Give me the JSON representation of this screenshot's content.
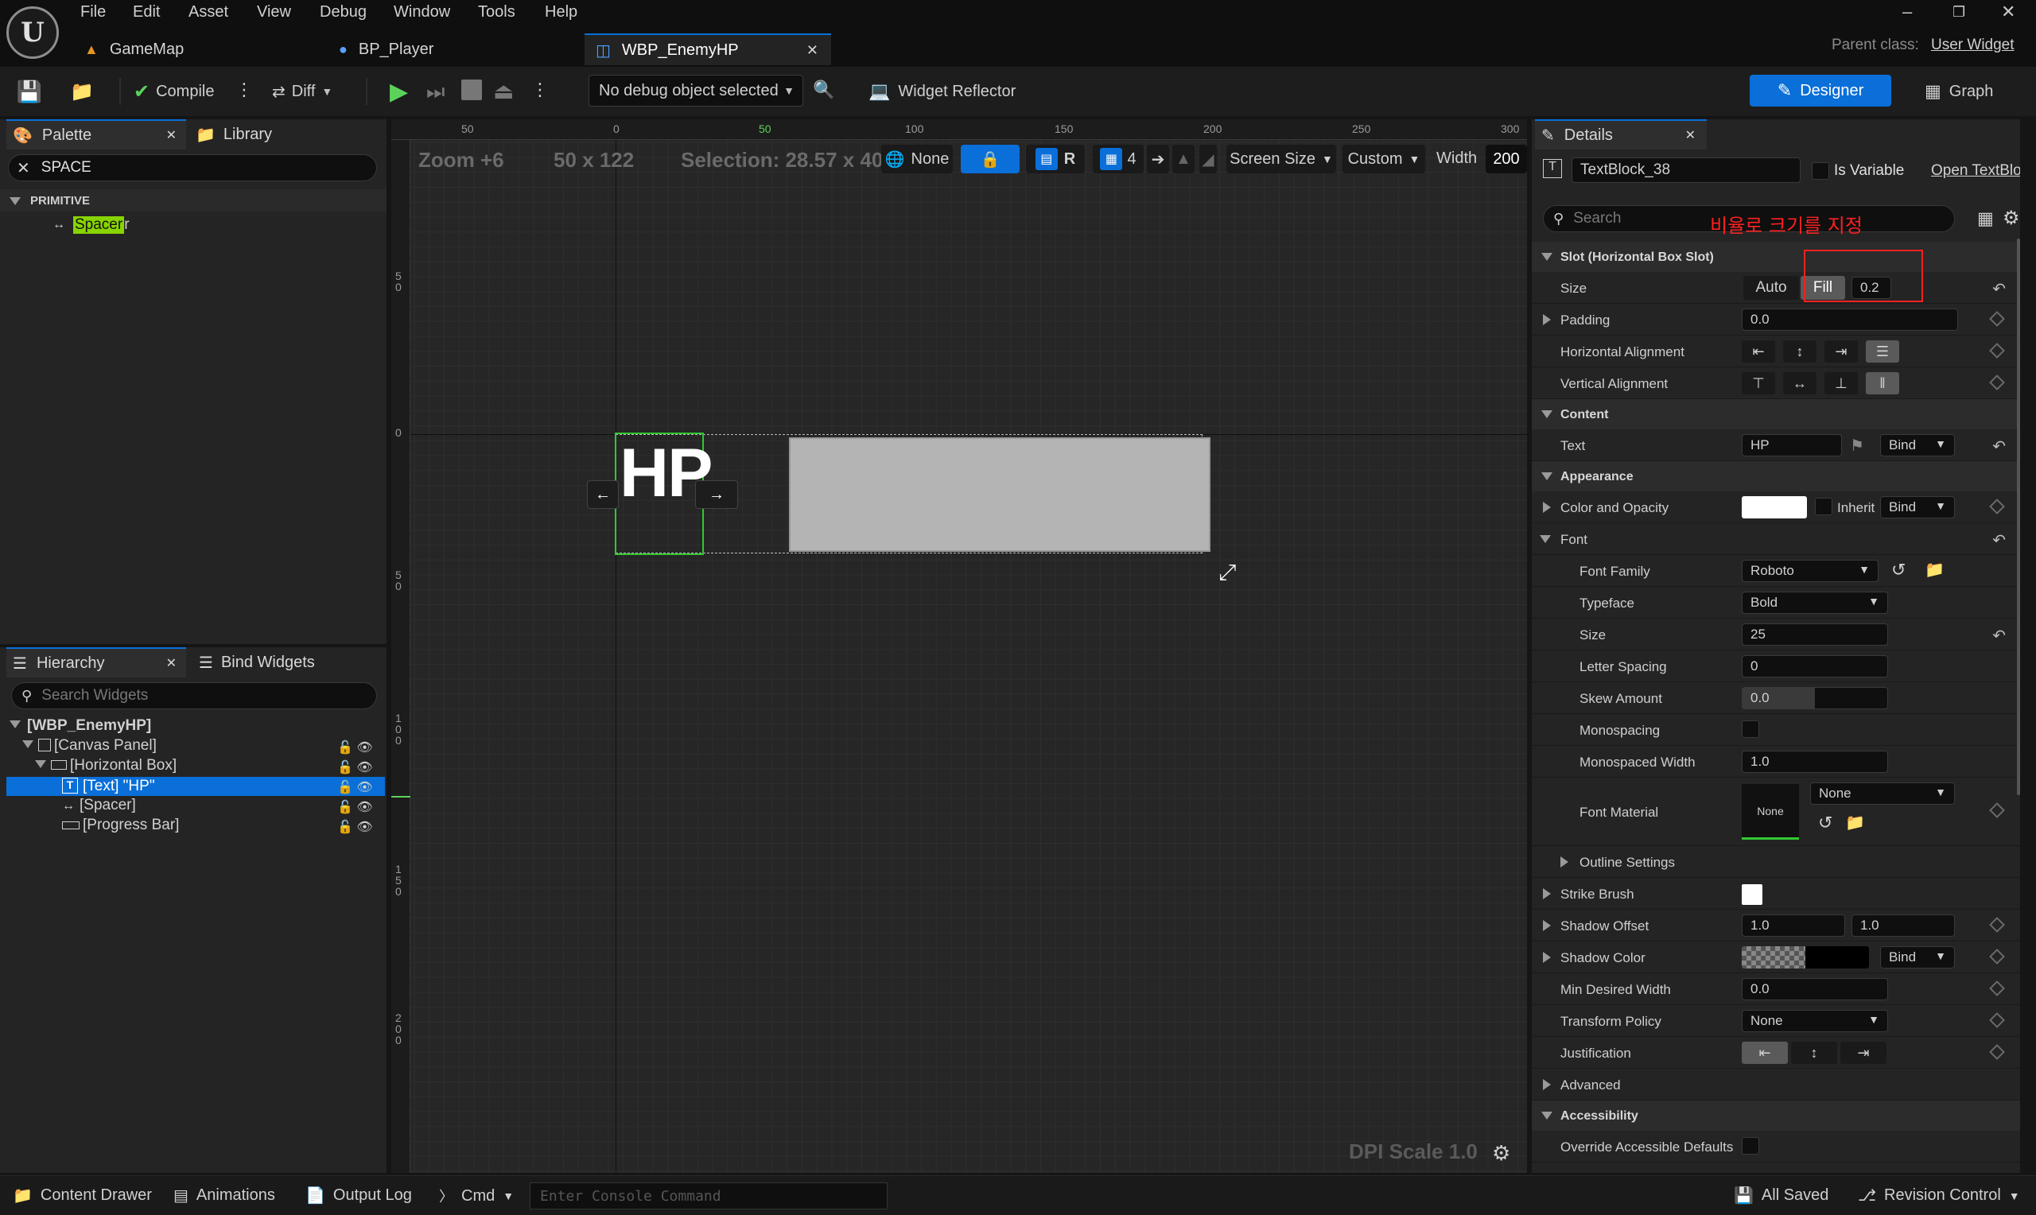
{
  "menu": {
    "items": [
      "File",
      "Edit",
      "Asset",
      "View",
      "Debug",
      "Window",
      "Tools",
      "Help"
    ]
  },
  "tabs": [
    {
      "label": "GameMap",
      "icon": "level-icon"
    },
    {
      "label": "BP_Player",
      "icon": "pawn-icon"
    },
    {
      "label": "WBP_EnemyHP",
      "icon": "widget-blueprint-icon",
      "active": true
    }
  ],
  "parent_class": {
    "label": "Parent class:",
    "value": "User Widget"
  },
  "toolbar": {
    "compile": "Compile",
    "diff": "Diff",
    "debug_object": "No debug object selected",
    "widget_reflector": "Widget Reflector",
    "designer": "Designer",
    "graph": "Graph"
  },
  "palette": {
    "tab": "Palette",
    "library_tab": "Library",
    "search_value": "SPACE",
    "category": "PRIMITIVE",
    "item_highlight": "Spacer",
    "item_rest": "r"
  },
  "hierarchy": {
    "tab": "Hierarchy",
    "bind_tab": "Bind Widgets",
    "search_placeholder": "Search Widgets",
    "items": [
      {
        "label": "[WBP_EnemyHP]"
      },
      {
        "label": "[Canvas Panel]"
      },
      {
        "label": "[Horizontal Box]"
      },
      {
        "label": "[Text] \"HP\"",
        "selected": true
      },
      {
        "label": "[Spacer]"
      },
      {
        "label": "[Progress Bar]"
      }
    ]
  },
  "designer": {
    "zoom": "Zoom +6",
    "size": "50 x 122",
    "selection": "Selection: 28.57 x 40",
    "localize": "None",
    "r": "R",
    "grid_snap": "4",
    "screen_size": "Screen Size",
    "custom": "Custom",
    "width_label": "Width",
    "width_value": "200",
    "dpi": "DPI Scale 1.0",
    "hp_text": "HP",
    "ruler_top": [
      "50",
      "0",
      "50",
      "100",
      "150",
      "200",
      "250",
      "300"
    ],
    "ruler_left": [
      "5\n0",
      "0",
      "5\n0",
      "1\n0\n0",
      "1\n5\n0",
      "2\n0\n0"
    ]
  },
  "details": {
    "tab": "Details",
    "widget_name": "TextBlock_38",
    "is_variable": "Is Variable",
    "open_link": "Open TextBloc",
    "search_placeholder": "Search",
    "annotation": "비율로 크기를 지정",
    "annotation_color": "#ff2020",
    "slot_section": "Slot (Horizontal Box Slot)",
    "size_label": "Size",
    "size_auto": "Auto",
    "size_fill": "Fill",
    "size_value": "0.2",
    "padding_label": "Padding",
    "padding_value": "0.0",
    "halign_label": "Horizontal Alignment",
    "valign_label": "Vertical Alignment",
    "content_section": "Content",
    "text_label": "Text",
    "text_value": "HP",
    "bind": "Bind",
    "appearance_section": "Appearance",
    "color_label": "Color and Opacity",
    "inherit": "Inherit",
    "font_label": "Font",
    "font_family_label": "Font Family",
    "font_family_value": "Roboto",
    "typeface_label": "Typeface",
    "typeface_value": "Bold",
    "font_size_label": "Size",
    "font_size_value": "25",
    "letter_spacing_label": "Letter Spacing",
    "letter_spacing_value": "0",
    "skew_label": "Skew Amount",
    "skew_value": "0.0",
    "monospacing_label": "Monospacing",
    "mono_width_label": "Monospaced Width",
    "mono_width_value": "1.0",
    "font_material_label": "Font Material",
    "font_material_thumb": "None",
    "font_material_value": "None",
    "outline_label": "Outline Settings",
    "strike_label": "Strike Brush",
    "shadow_offset_label": "Shadow Offset",
    "shadow_offset_x": "1.0",
    "shadow_offset_y": "1.0",
    "shadow_color_label": "Shadow Color",
    "min_width_label": "Min Desired Width",
    "min_width_value": "0.0",
    "transform_label": "Transform Policy",
    "transform_value": "None",
    "justification_label": "Justification",
    "advanced": "Advanced",
    "accessibility_section": "Accessibility",
    "override_label": "Override Accessible Defaults"
  },
  "status": {
    "content_drawer": "Content Drawer",
    "animations": "Animations",
    "output_log": "Output Log",
    "cmd": "Cmd",
    "console_placeholder": "Enter Console Command",
    "all_saved": "All Saved",
    "revision": "Revision Control"
  },
  "colors": {
    "accent": "#0a6fd8",
    "selection": "#0a6fd8",
    "highlight": "#1e90ff",
    "spacer_highlight": "#88d400"
  }
}
